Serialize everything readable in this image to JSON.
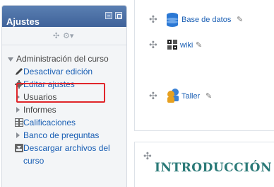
{
  "settings_block": {
    "title": "Ajustes",
    "controls": [
      "✣",
      "⚙▾"
    ],
    "items": [
      {
        "label": "Administración del curso",
        "icon": "triangle-down-icon"
      },
      {
        "label": "Desactivar edición",
        "icon": "pencil-icon"
      },
      {
        "label": "Editar ajustes",
        "icon": "gear-icon",
        "highlighted": true
      },
      {
        "label": "Usuarios",
        "icon": "triangle-right-icon"
      },
      {
        "label": "Informes",
        "icon": "triangle-right-icon"
      },
      {
        "label": "Calificaciones",
        "icon": "grid-icon"
      },
      {
        "label": "Banco de preguntas",
        "icon": "triangle-right-icon"
      },
      {
        "label": "Descargar archivos del",
        "label2": "curso",
        "icon": "download-icon"
      }
    ]
  },
  "course": {
    "activities": [
      {
        "name": "Base de datos",
        "icon": "database-icon"
      },
      {
        "name": "wiki",
        "icon": "wiki-icon"
      },
      {
        "name": "Taller",
        "icon": "workshop-icon"
      }
    ],
    "section_title": "INTRODUCCIÓN"
  },
  "colors": {
    "link": "#1a5fb4",
    "header": "#4a6fa5",
    "highlight": "#e0262b",
    "section_title": "#2b7a78"
  }
}
